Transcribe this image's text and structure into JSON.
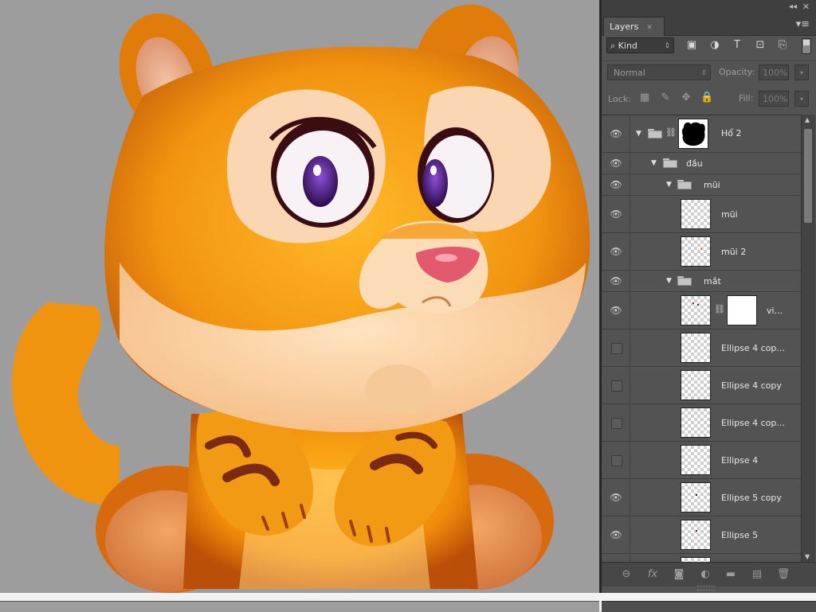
{
  "panel": {
    "collapse_glyph": "◂◂",
    "close_glyph": "✕",
    "tab_label": "Layers",
    "tab_close": "✕",
    "menu_glyph": "▾≡",
    "filter": {
      "search_glyph": "⌕",
      "kind_label": "Kind",
      "arrows": "⇕",
      "icons": [
        "image-filter-icon",
        "adjustment-filter-icon",
        "type-filter-icon",
        "shape-filter-icon",
        "smart-object-filter-icon"
      ],
      "glyphs": [
        "▣",
        "◑",
        "T",
        "⊡",
        "⎘"
      ]
    },
    "blend_mode": "Normal",
    "blend_arrows": "⇕",
    "opacity_label": "Opacity:",
    "opacity_value": "100%",
    "lock_label": "Lock:",
    "lock_glyphs": [
      "▦",
      "✎",
      "✥",
      "🔒"
    ],
    "fill_label": "Fill:",
    "fill_value": "100%",
    "drop_glyph": "▾"
  },
  "layers": [
    {
      "name": "Hổ 2",
      "type": "group-mask",
      "visible": true,
      "depth": 0,
      "expanded": true
    },
    {
      "name": "đầu",
      "type": "group",
      "visible": true,
      "depth": 1,
      "expanded": true
    },
    {
      "name": "mũi",
      "type": "group",
      "visible": true,
      "depth": 2,
      "expanded": true
    },
    {
      "name": "mũi",
      "type": "layer",
      "visible": true,
      "depth": 3
    },
    {
      "name": "mũi 2",
      "type": "layer",
      "visible": true,
      "depth": 3
    },
    {
      "name": "mắt",
      "type": "group",
      "visible": true,
      "depth": 2,
      "expanded": true
    },
    {
      "name": "vi...",
      "type": "layer-mask",
      "visible": true,
      "depth": 3
    },
    {
      "name": "Ellipse 4 cop...",
      "type": "layer",
      "visible": false,
      "depth": 3
    },
    {
      "name": "Ellipse 4 copy",
      "type": "layer",
      "visible": false,
      "depth": 3
    },
    {
      "name": "Ellipse 4 cop...",
      "type": "layer",
      "visible": false,
      "depth": 3
    },
    {
      "name": "Ellipse 4",
      "type": "layer",
      "visible": false,
      "depth": 3
    },
    {
      "name": "Ellipse 5 copy",
      "type": "layer",
      "visible": true,
      "depth": 3
    },
    {
      "name": "Ellipse 5",
      "type": "layer",
      "visible": true,
      "depth": 3
    },
    {
      "name": "",
      "type": "layer",
      "visible": false,
      "depth": 3
    }
  ],
  "footer": {
    "icons": [
      "link-layers-icon",
      "fx-icon",
      "add-mask-icon",
      "adjustment-layer-icon",
      "new-group-icon",
      "new-layer-icon",
      "delete-layer-icon"
    ],
    "glyphs": [
      "⊖",
      "fx",
      "◙",
      "◐",
      "▬",
      "▤",
      "🗑"
    ]
  },
  "scroll": {
    "up": "▲",
    "down": "▼"
  },
  "colors": {
    "canvas_bg": "#9d9d9d",
    "panel_bg": "#535353",
    "tiger_orange": "#f29a10"
  }
}
